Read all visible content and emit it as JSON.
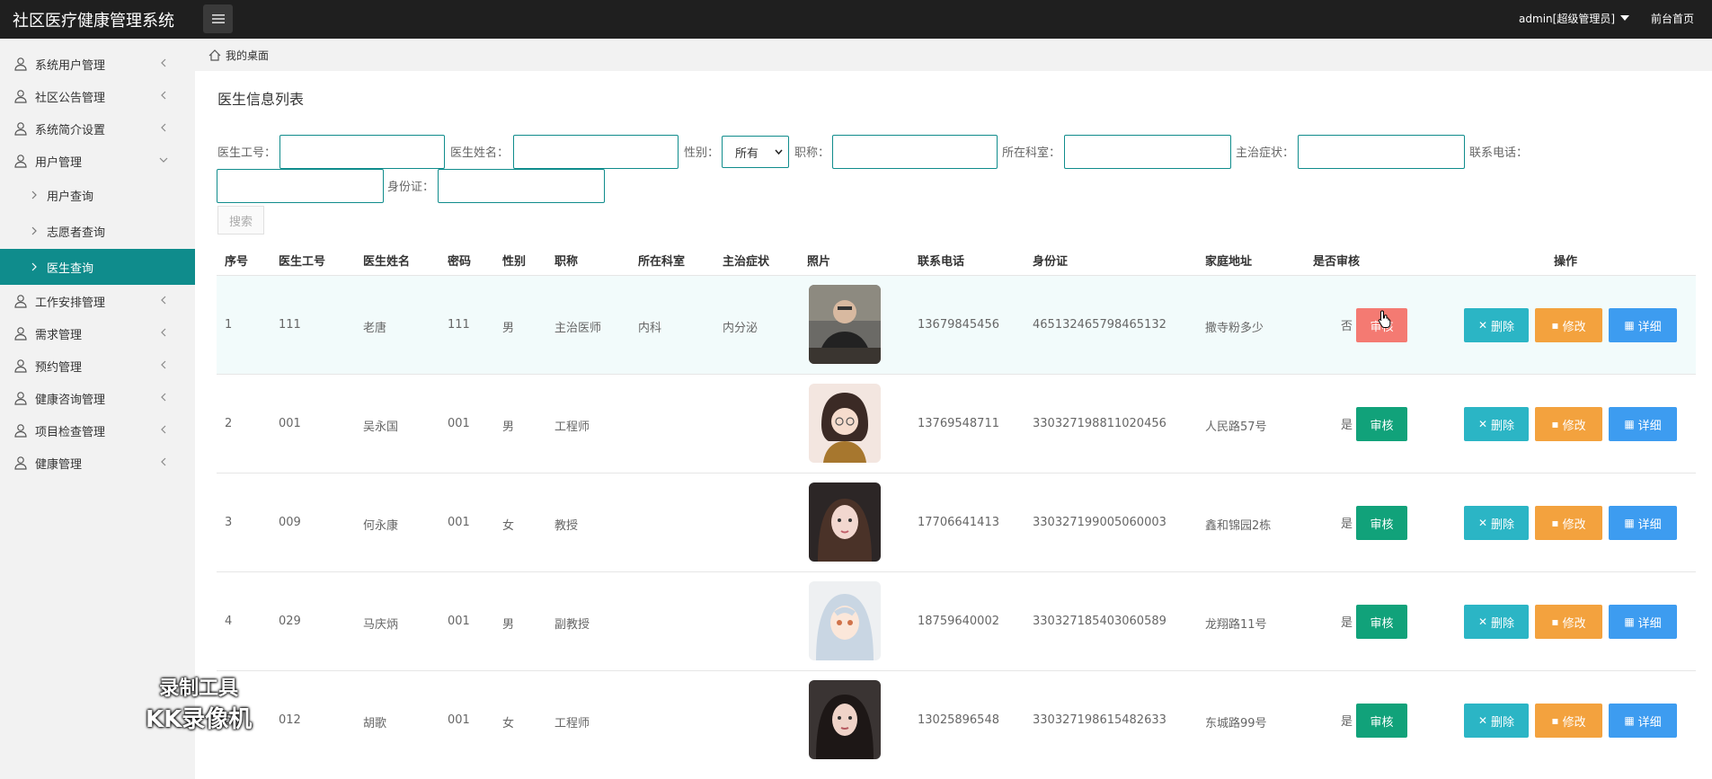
{
  "app": {
    "title": "社区医疗健康管理系统"
  },
  "topbar": {
    "user_label": "admin[超级管理员]",
    "front_link": "前台首页"
  },
  "sidebar": {
    "items": [
      {
        "label": "系统用户管理"
      },
      {
        "label": "社区公告管理"
      },
      {
        "label": "系统简介设置"
      },
      {
        "label": "用户管理",
        "expanded": true
      },
      {
        "label": "工作安排管理"
      },
      {
        "label": "需求管理"
      },
      {
        "label": "预约管理"
      },
      {
        "label": "健康咨询管理"
      },
      {
        "label": "项目检查管理"
      },
      {
        "label": "健康管理"
      }
    ],
    "subitems": [
      {
        "label": "用户查询"
      },
      {
        "label": "志愿者查询"
      },
      {
        "label": "医生查询",
        "active": true
      }
    ]
  },
  "breadcrumb": {
    "label": "我的桌面"
  },
  "page": {
    "title": "医生信息列表"
  },
  "filters": {
    "doctor_no": "医生工号：",
    "doctor_name": "医生姓名：",
    "gender": "性别：",
    "gender_value": "所有",
    "title": "职称：",
    "department": "所在科室：",
    "specialty": "主治症状：",
    "phone": "联系电话：",
    "id_card": "身份证：",
    "search": "搜索"
  },
  "table": {
    "headers": [
      "序号",
      "医生工号",
      "医生姓名",
      "密码",
      "性别",
      "职称",
      "所在科室",
      "主治症状",
      "照片",
      "联系电话",
      "身份证",
      "家庭地址",
      "是否审核",
      "操作"
    ],
    "rows": [
      {
        "idx": "1",
        "no": "111",
        "name": "老唐",
        "pwd": "111",
        "gender": "男",
        "title": "主治医师",
        "dept": "内科",
        "spec": "内分泌",
        "phone": "13679845456",
        "id": "465132465798465132",
        "addr": "撒寺粉多少",
        "audited": "否"
      },
      {
        "idx": "2",
        "no": "001",
        "name": "吴永国",
        "pwd": "001",
        "gender": "男",
        "title": "工程师",
        "dept": "",
        "spec": "",
        "phone": "13769548711",
        "id": "330327198811020456",
        "addr": "人民路57号",
        "audited": "是"
      },
      {
        "idx": "3",
        "no": "009",
        "name": "何永康",
        "pwd": "001",
        "gender": "女",
        "title": "教授",
        "dept": "",
        "spec": "",
        "phone": "17706641413",
        "id": "330327199005060003",
        "addr": "鑫和锦园2栋",
        "audited": "是"
      },
      {
        "idx": "4",
        "no": "029",
        "name": "马庆炳",
        "pwd": "001",
        "gender": "男",
        "title": "副教授",
        "dept": "",
        "spec": "",
        "phone": "18759640002",
        "id": "330327185403060589",
        "addr": "龙翔路11号",
        "audited": "是"
      },
      {
        "idx": "5",
        "no": "012",
        "name": "胡歌",
        "pwd": "001",
        "gender": "女",
        "title": "工程师",
        "dept": "",
        "spec": "",
        "phone": "13025896548",
        "id": "330327198615482633",
        "addr": "东城路99号",
        "audited": "是"
      }
    ],
    "audit_label": "审核",
    "delete_label": "删除",
    "edit_label": "修改",
    "detail_label": "详细"
  },
  "watermark": {
    "line1": "录制工具",
    "line2": "KK录像机"
  },
  "colors": {
    "accent": "#0f8c8c",
    "topbar": "#1f1f1f",
    "audit_green": "#11a27a",
    "audit_red": "#f47a72",
    "delete": "#2bb5c5",
    "edit": "#f3a23e",
    "detail": "#3d9cf0"
  }
}
